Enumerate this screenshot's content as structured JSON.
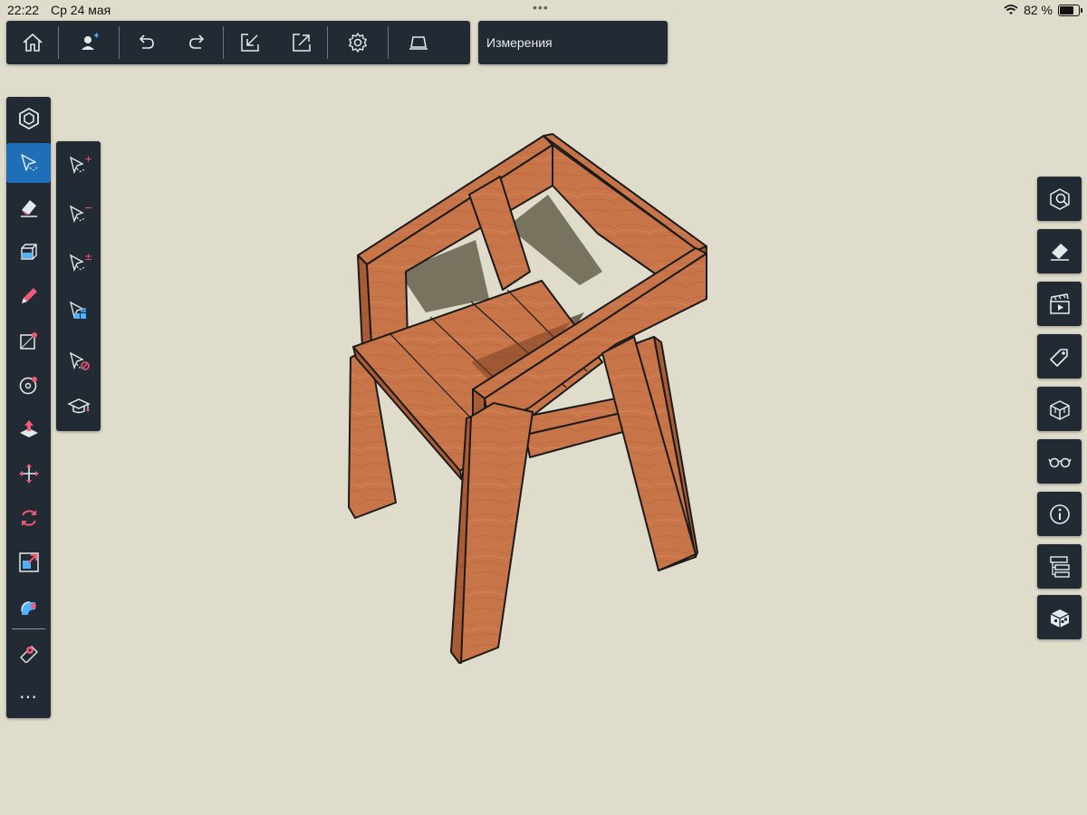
{
  "status_bar": {
    "time": "22:22",
    "date": "Ср 24 мая",
    "battery": "82 %",
    "battery_level": 0.82,
    "icons": [
      "wifi-icon",
      "battery-icon"
    ]
  },
  "top_toolbar": {
    "buttons": [
      {
        "name": "home",
        "icon": "home-icon"
      },
      {
        "name": "account",
        "icon": "user-add-icon"
      },
      {
        "name": "undo",
        "icon": "undo-icon"
      },
      {
        "name": "redo",
        "icon": "redo-icon"
      },
      {
        "name": "import",
        "icon": "import-icon"
      },
      {
        "name": "export",
        "icon": "export-icon"
      },
      {
        "name": "settings",
        "icon": "gear-icon"
      },
      {
        "name": "display",
        "icon": "laptop-icon"
      }
    ]
  },
  "measurements": {
    "label": "Измерения"
  },
  "left_toolbar": {
    "tools": [
      {
        "name": "model-info",
        "icon": "hexagon-logo-icon"
      },
      {
        "name": "select",
        "icon": "select-arrow-icon",
        "active": true
      },
      {
        "name": "eraser",
        "icon": "eraser-icon"
      },
      {
        "name": "paint-bucket",
        "icon": "box-paint-icon"
      },
      {
        "name": "pencil",
        "icon": "pencil-icon"
      },
      {
        "name": "rectangle",
        "icon": "rectangle-icon"
      },
      {
        "name": "circle",
        "icon": "circle-icon"
      },
      {
        "name": "push-pull",
        "icon": "push-pull-icon"
      },
      {
        "name": "move",
        "icon": "move-icon"
      },
      {
        "name": "rotate",
        "icon": "rotate-icon"
      },
      {
        "name": "scale",
        "icon": "scale-icon"
      },
      {
        "name": "follow-me",
        "icon": "follow-me-icon"
      },
      {
        "name": "tape-measure",
        "icon": "tape-measure-icon"
      }
    ],
    "more_label": "⋯"
  },
  "select_subtools": [
    {
      "name": "select-add",
      "icon": "select-add-icon",
      "mark": "+"
    },
    {
      "name": "select-subtract",
      "icon": "select-subtract-icon",
      "mark": "−"
    },
    {
      "name": "select-toggle",
      "icon": "select-toggle-icon",
      "mark": "±"
    },
    {
      "name": "select-similar",
      "icon": "select-similar-icon"
    },
    {
      "name": "select-none",
      "icon": "select-none-icon"
    },
    {
      "name": "instructor",
      "icon": "graduation-cap-icon"
    }
  ],
  "right_panel": {
    "buttons": [
      {
        "name": "entity-info",
        "icon": "entity-info-icon"
      },
      {
        "name": "materials",
        "icon": "materials-icon"
      },
      {
        "name": "scenes",
        "icon": "clapper-icon"
      },
      {
        "name": "tags",
        "icon": "tag-icon"
      },
      {
        "name": "components",
        "icon": "components-icon"
      },
      {
        "name": "styles",
        "icon": "glasses-icon"
      },
      {
        "name": "info",
        "icon": "info-icon"
      },
      {
        "name": "outliner",
        "icon": "outliner-icon"
      },
      {
        "name": "view",
        "icon": "view-cube-icon"
      }
    ]
  },
  "colors": {
    "background": "#dfdccb",
    "panel": "#222b33",
    "active_tool": "#1f6fb8",
    "accent": "#f05a78",
    "wood": "#c9754a",
    "wood_light": "#d99366",
    "wood_dark": "#8e4d2d"
  }
}
